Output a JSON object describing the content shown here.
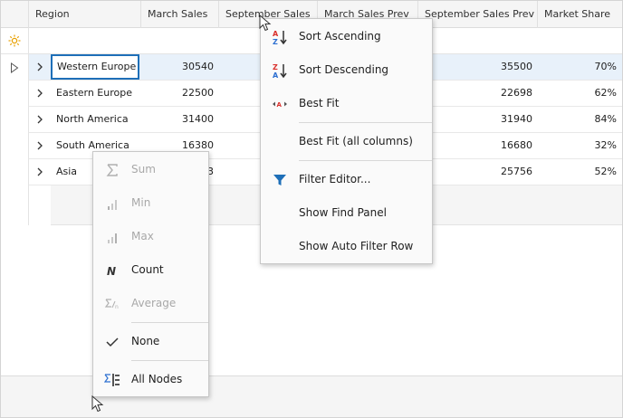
{
  "columns": {
    "region": "Region",
    "march_sales": "March Sales",
    "september_sales": "September Sales",
    "march_sales_prev": "March Sales Prev",
    "september_sales_prev": "September Sales Prev",
    "market_share": "Market Share"
  },
  "rows": [
    {
      "region": "Western Europe",
      "march_sales": "30540",
      "september_sales_prev": "35500",
      "market_share": "70%"
    },
    {
      "region": "Eastern Europe",
      "march_sales": "22500",
      "september_sales_prev": "22698",
      "market_share": "62%"
    },
    {
      "region": "North America",
      "march_sales": "31400",
      "september_sales_prev": "31940",
      "market_share": "84%"
    },
    {
      "region": "South America",
      "march_sales": "16380",
      "september_sales_prev": "16680",
      "market_share": "32%"
    },
    {
      "region": "Asia",
      "march_sales": "3",
      "march_sales_fragment": "3",
      "september_sales_prev": "25756",
      "market_share": "52%"
    }
  ],
  "column_menu": {
    "sort_ascending": "Sort Ascending",
    "sort_descending": "Sort Descending",
    "best_fit": "Best Fit",
    "best_fit_all": "Best Fit (all columns)",
    "filter_editor": "Filter Editor...",
    "show_find_panel": "Show Find Panel",
    "show_auto_filter_row": "Show Auto Filter Row"
  },
  "summary_menu": {
    "sum": "Sum",
    "min": "Min",
    "max": "Max",
    "count": "Count",
    "average": "Average",
    "none": "None",
    "all_nodes": "All Nodes"
  },
  "colors": {
    "accent": "#1e6fb8",
    "focused_row": "#e8f1fa",
    "filter_icon": "#e8a000",
    "sort_red": "#d9302c",
    "sort_blue": "#2c6fd1"
  }
}
